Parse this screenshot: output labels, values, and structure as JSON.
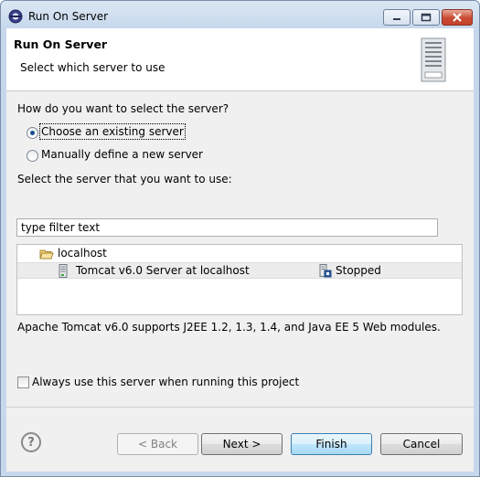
{
  "window": {
    "title": "Run On Server"
  },
  "header": {
    "title": "Run On Server",
    "description": "Select which server to use"
  },
  "selection": {
    "question": "How do you want to select the server?",
    "options": [
      {
        "label": "Choose an existing server",
        "checked": true
      },
      {
        "label": "Manually define a new server",
        "checked": false
      }
    ],
    "select_label": "Select the server that you want to use:",
    "filter_value": "type filter text"
  },
  "tree": {
    "host": "localhost",
    "servers": [
      {
        "name": "Tomcat v6.0 Server at localhost",
        "state": "Stopped"
      }
    ]
  },
  "description": "Apache Tomcat v6.0 supports J2EE 1.2, 1.3, 1.4, and Java EE 5 Web modules.",
  "always_use": {
    "label": "Always use this server when running this project",
    "checked": false
  },
  "buttons": {
    "help": "?",
    "back": "< Back",
    "next": "Next >",
    "finish": "Finish",
    "cancel": "Cancel"
  }
}
